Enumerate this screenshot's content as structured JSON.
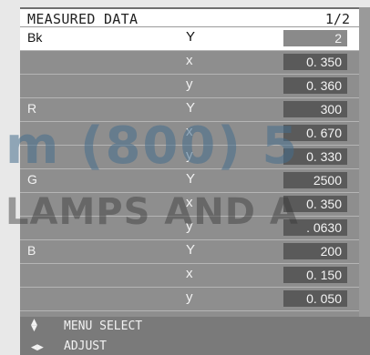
{
  "header": {
    "title": "MEASURED DATA",
    "page": "1/2"
  },
  "rows": [
    {
      "group": "Bk",
      "param": "Y",
      "value": "2"
    },
    {
      "group": "",
      "param": "x",
      "value": "0. 350"
    },
    {
      "group": "",
      "param": "y",
      "value": "0. 360"
    },
    {
      "group": "R",
      "param": "Y",
      "value": "300"
    },
    {
      "group": "",
      "param": "x",
      "value": "0. 670"
    },
    {
      "group": "",
      "param": "y",
      "value": "0. 330"
    },
    {
      "group": "G",
      "param": "Y",
      "value": "2500"
    },
    {
      "group": "",
      "param": "x",
      "value": "0. 350"
    },
    {
      "group": "",
      "param": "y",
      "value": ". 0630"
    },
    {
      "group": "B",
      "param": "Y",
      "value": "200"
    },
    {
      "group": "",
      "param": "x",
      "value": "0. 150"
    },
    {
      "group": "",
      "param": "y",
      "value": "0. 050"
    }
  ],
  "footer": {
    "menu_select": {
      "icon": "up-down-arrows-icon",
      "glyph": "◆",
      "label": "MENU SELECT"
    },
    "adjust": {
      "icon": "left-right-arrows-icon",
      "glyph": "◆",
      "label": "ADJUST"
    }
  },
  "watermark": {
    "line1": "m (800) 5",
    "line2": "LAMPS AND A"
  },
  "colors": {
    "panel": "#8e8e8e",
    "header_bg": "#ffffff",
    "value_box": "#5a5a5a",
    "selected_row": "#ffffff",
    "footer": "#7a7a7a"
  }
}
